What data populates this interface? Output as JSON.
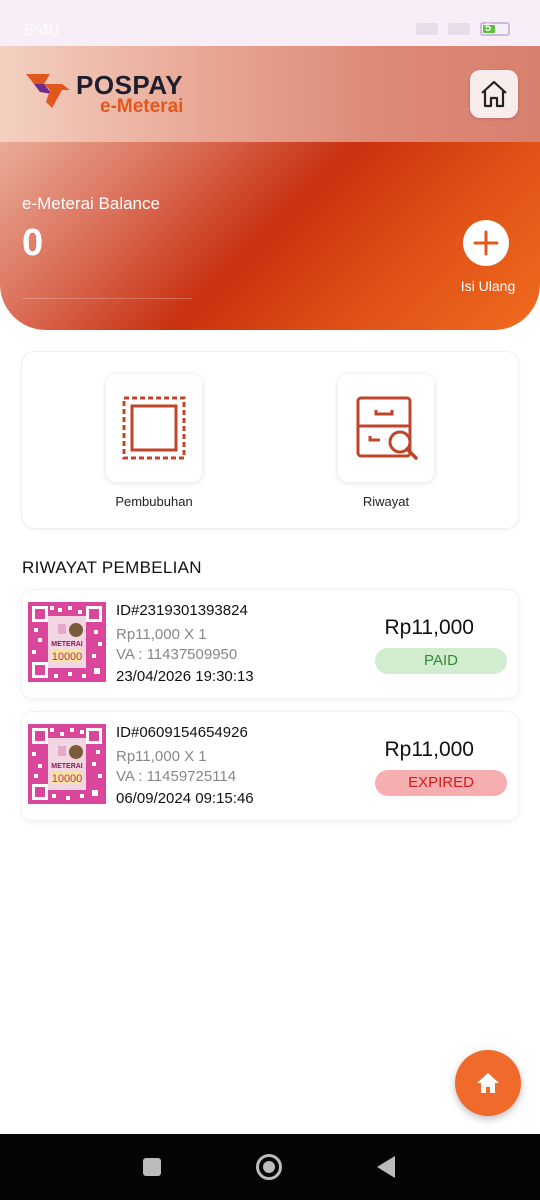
{
  "status_bar": {
    "time": "6:40",
    "battery": "5"
  },
  "app": {
    "brand_name": "POSPAY",
    "brand_sub": "e-Meterai"
  },
  "balance": {
    "label": "e-Meterai Balance",
    "value": "0",
    "topup_label": "Isi Ulang"
  },
  "menu": [
    {
      "label": "Pembubuhan",
      "icon": "stamp-frame-icon"
    },
    {
      "label": "Riwayat",
      "icon": "cabinet-search-icon"
    }
  ],
  "history": {
    "title": "RIWAYAT PEMBELIAN",
    "items": [
      {
        "id": "ID#2319301393824",
        "qty": "Rp11,000 X 1",
        "va": "VA : 11437509950",
        "date": "23/04/2026 19:30:13",
        "amount": "Rp11,000",
        "status": "PAID"
      },
      {
        "id": "ID#0609154654926",
        "qty": "Rp11,000 X 1",
        "va": "VA : 11459725114",
        "date": "06/09/2024 09:15:46",
        "amount": "Rp11,000",
        "status": "EXPIRED"
      }
    ]
  },
  "stamp_image": {
    "title": "METERAI",
    "value": "10000"
  },
  "colors": {
    "accent": "#e2571b",
    "paid": "#2e8b2f",
    "expired": "#d21b1b",
    "fab": "#ef6a2b"
  }
}
